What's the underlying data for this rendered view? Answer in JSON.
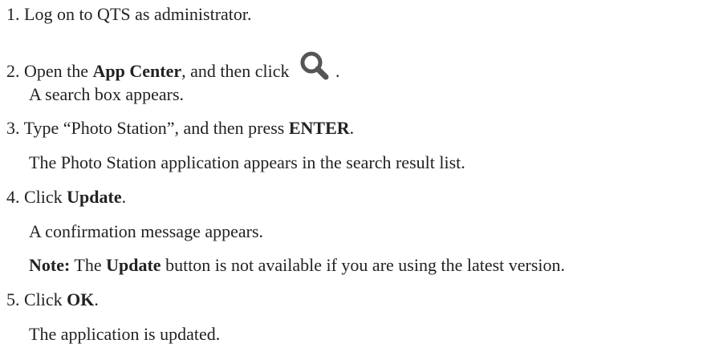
{
  "steps": {
    "s1": {
      "text": "1. Log on to QTS as administrator."
    },
    "s2": {
      "prefix": "2. Open the ",
      "bold": "App Center",
      "middle": ", and then click ",
      "icon": "search-icon",
      "suffix": ".",
      "result": "A search box appears."
    },
    "s3": {
      "prefix": "3. Type “Photo Station”, and then press ",
      "bold": "ENTER",
      "suffix": ".",
      "result": "The Photo Station application appears in the search result list."
    },
    "s4": {
      "prefix": "4. Click ",
      "bold": "Update",
      "suffix": ".",
      "result": "A confirmation message appears.",
      "note_label": "Note:",
      "note_pre": " The ",
      "note_bold": "Update",
      "note_post": " button is not available if you are using the latest version."
    },
    "s5": {
      "prefix": "5. Click ",
      "bold": "OK",
      "suffix": ".",
      "result": "The application is updated."
    }
  },
  "colors": {
    "text": "#222222",
    "icon": "#555555"
  }
}
